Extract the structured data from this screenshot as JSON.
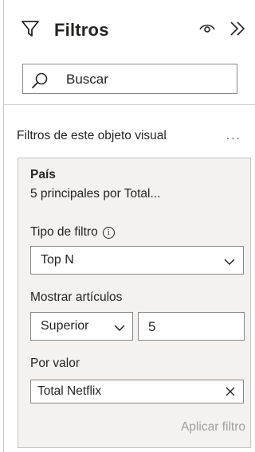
{
  "header": {
    "title": "Filtros"
  },
  "search": {
    "placeholder": "Buscar"
  },
  "section": {
    "title": "Filtros de este objeto visual",
    "more": "..."
  },
  "card": {
    "field": "País",
    "summary": "5 principales por Total...",
    "filter_type_label": "Tipo de filtro",
    "filter_type_value": "Top N",
    "show_items_label": "Mostrar artículos",
    "show_items_direction": "Superior",
    "show_items_count": "5",
    "by_value_label": "Por valor",
    "by_value_field": "Total Netflix",
    "apply_label": "Aplicar filtro"
  },
  "icons": [
    "filter-icon",
    "eye-icon",
    "collapse-icon",
    "search-icon",
    "info-icon",
    "chevron-down-icon",
    "close-icon",
    "more-icon"
  ]
}
